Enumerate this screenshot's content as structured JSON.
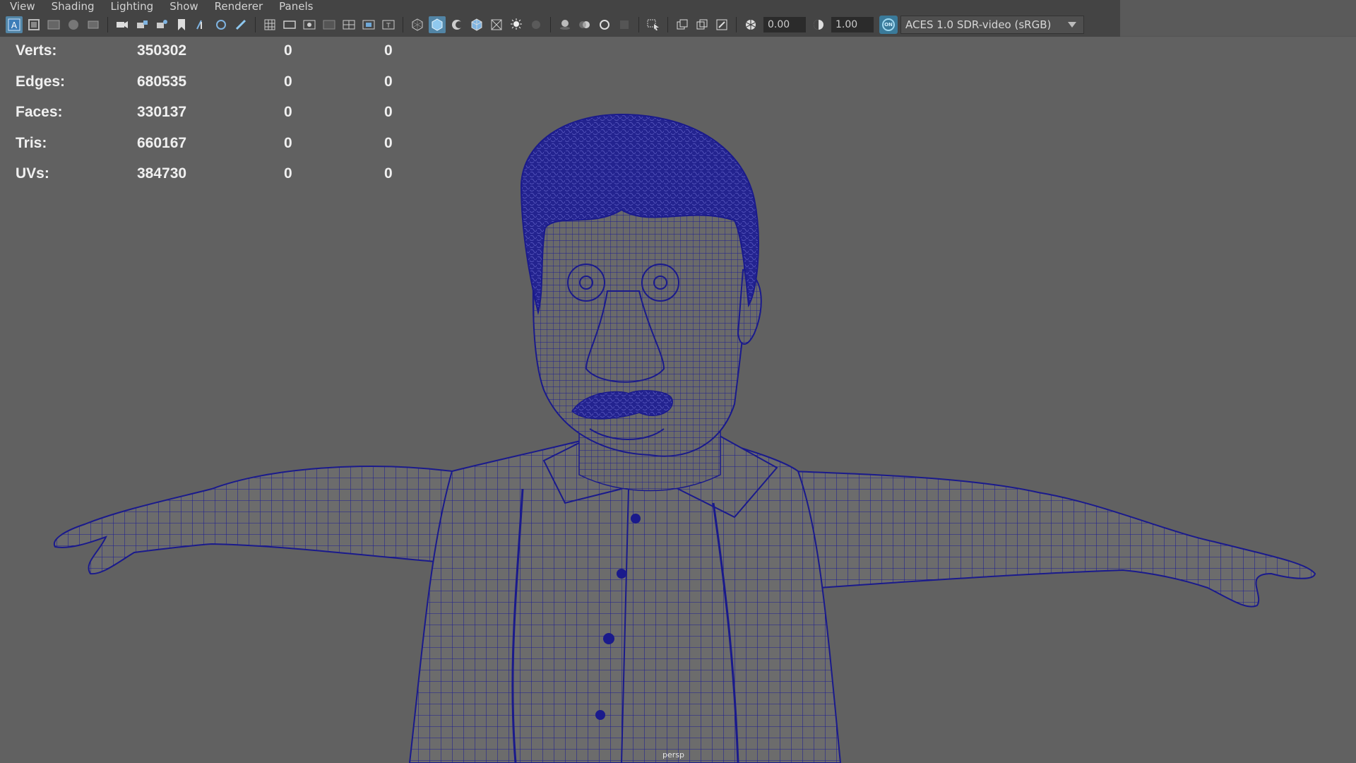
{
  "menubar": {
    "items": [
      "View",
      "Shading",
      "Lighting",
      "Show",
      "Renderer",
      "Panels"
    ]
  },
  "toolbar": {
    "icons": [
      "select-camera-icon",
      "camera-attributes-icon",
      "bookmarks-icon",
      "image-plane-icon",
      "2d-pan-zoom-icon",
      "camera-icon",
      "lock-camera-icon",
      "camera-sequence-icon",
      "bookmark-icon",
      "grease-pencil-icon",
      "paint-icon",
      "grid-icon",
      "film-gate-icon",
      "resolution-gate-icon",
      "gate-mask-icon",
      "field-chart-icon",
      "safe-action-icon",
      "safe-title-icon",
      "wireframe-icon",
      "smooth-shade-icon",
      "use-default-material-icon",
      "wireframe-on-shaded-icon",
      "textured-icon",
      "lights-icon",
      "shadows-icon",
      "ambient-occlusion-icon",
      "motion-blur-icon",
      "antialiasing-icon",
      "depth-of-field-icon",
      "isolate-select-icon",
      "xray-icon",
      "xray-joints-icon",
      "xray-active-components-icon"
    ],
    "exposure": "0.00",
    "gamma": "1.00",
    "color_management_badge": "ON",
    "color_space": "ACES 1.0 SDR-video (sRGB)"
  },
  "hud": {
    "rows": [
      {
        "label": "Verts:",
        "v1": "350302",
        "v2": "0",
        "v3": "0"
      },
      {
        "label": "Edges:",
        "v1": "680535",
        "v2": "0",
        "v3": "0"
      },
      {
        "label": "Faces:",
        "v1": "330137",
        "v2": "0",
        "v3": "0"
      },
      {
        "label": "Tris:",
        "v1": "660167",
        "v2": "0",
        "v3": "0"
      },
      {
        "label": "UVs:",
        "v1": "384730",
        "v2": "0",
        "v3": "0"
      }
    ]
  },
  "viewport": {
    "camera": "persp",
    "wire_color": "#1a1a8c",
    "mesh_color": "#6e6e6e",
    "background_color": "#616161"
  }
}
